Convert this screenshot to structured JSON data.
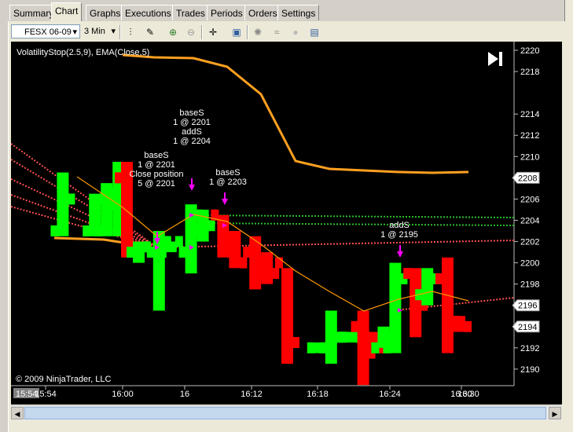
{
  "tabs": [
    {
      "label": "Summary",
      "active": false
    },
    {
      "label": "Chart",
      "active": true
    },
    {
      "label": "Graphs",
      "active": false
    },
    {
      "label": "Executions",
      "active": false
    },
    {
      "label": "Trades",
      "active": false
    },
    {
      "label": "Periods",
      "active": false
    },
    {
      "label": "Orders",
      "active": false
    },
    {
      "label": "Settings",
      "active": false
    }
  ],
  "toolbar": {
    "instrument": "FESX 06-09",
    "interval": "3 Min",
    "icons": [
      "bar-chart-icon",
      "pencil-icon",
      "zoom-in-icon",
      "zoom-out-icon",
      "crosshair-icon",
      "properties-icon",
      "strategy-icon",
      "indicator-icon",
      "refresh-icon",
      "data-box-icon"
    ]
  },
  "chart": {
    "indicator_label": "VolatilityStop(2.5,9), EMA(Close,5)",
    "copyright": "© 2009 NinjaTrader, LLC",
    "time_tick_labels": [
      "15:54",
      "16:00",
      "16",
      "16:06",
      "16:12",
      "16:18",
      "16:24",
      "16:30"
    ],
    "price_tick_labels": [
      "2220",
      "2218",
      "2214",
      "2212",
      "2210",
      "2206",
      "2204",
      "2202",
      "2200",
      "2198",
      "2192",
      "2190"
    ],
    "price_badges": [
      "2208",
      "2196",
      "2194"
    ],
    "cursor_time": "15:54",
    "annotations": [
      {
        "lines": [
          "baseS",
          "1 @ 2201",
          "Close position",
          "5 @ 2201"
        ]
      },
      {
        "lines": [
          "baseS",
          "1 @ 2201",
          "addS",
          "1 @ 2204"
        ]
      },
      {
        "lines": [
          "baseS",
          "1 @ 2203"
        ]
      },
      {
        "lines": [
          "addS",
          "1 @ 2195"
        ]
      }
    ],
    "colors": {
      "up": "#00ff00",
      "down": "#ff0000",
      "ema": "#ff9900",
      "vstop": "#ffa020",
      "bg": "#000000",
      "marker": "#ff00ff"
    }
  },
  "chart_data": {
    "type": "bar",
    "x_range": [
      "15:54",
      "16:33"
    ],
    "ylim": [
      2188.5,
      2220.5
    ],
    "y_ticks": [
      2190,
      2192,
      2194,
      2196,
      2198,
      2200,
      2202,
      2204,
      2206,
      2208,
      2210,
      2212,
      2214,
      2216,
      2218,
      2220
    ],
    "bars": [
      {
        "time": "15:54",
        "open": 2203,
        "high": 2208.5,
        "low": 2202.5,
        "close": 2206
      },
      {
        "time": "15:57",
        "open": 2203,
        "high": 2206.5,
        "low": 2202.5,
        "close": 2206
      },
      {
        "time": "15:57",
        "open": 2203,
        "high": 2207.5,
        "low": 2202.5,
        "close": 2206.5
      },
      {
        "time": "15:57",
        "open": 2205.5,
        "high": 2209.5,
        "low": 2202.5,
        "close": 2208
      },
      {
        "time": "16:00",
        "open": 2208,
        "high": 2209.5,
        "low": 2200.5,
        "close": 2201.5
      },
      {
        "time": "16:00",
        "open": 2201,
        "high": 2202,
        "low": 2200,
        "close": 2201.5
      },
      {
        "time": "16:03",
        "open": 2201,
        "high": 2203,
        "low": 2195.5,
        "close": 2202
      },
      {
        "time": "16:03",
        "open": 2201,
        "high": 2202,
        "low": 2201,
        "close": 2202
      },
      {
        "time": "16:06",
        "open": 2201,
        "high": 2205.5,
        "low": 2199,
        "close": 2204.5
      },
      {
        "time": "16:06",
        "open": 2203,
        "high": 2205,
        "low": 2202,
        "close": 2203.5
      },
      {
        "time": "16:09",
        "open": 2204.5,
        "high": 2204.5,
        "low": 2200.5,
        "close": 2201
      },
      {
        "time": "16:09",
        "open": 2202,
        "high": 2203,
        "low": 2199.5,
        "close": 2200
      },
      {
        "time": "16:12",
        "open": 2201,
        "high": 2202.5,
        "low": 2197.5,
        "close": 2199
      },
      {
        "time": "16:12",
        "open": 2200,
        "high": 2201,
        "low": 2198,
        "close": 2199
      },
      {
        "time": "16:15",
        "open": 2200,
        "high": 2199.5,
        "low": 2190.5,
        "close": 2192.5
      },
      {
        "time": "16:18",
        "open": 2192,
        "high": 2192.5,
        "low": 2191.5,
        "close": 2192
      },
      {
        "time": "16:18",
        "open": 2192,
        "high": 2195.5,
        "low": 2190.5,
        "close": 2193
      },
      {
        "time": "16:21",
        "open": 2193,
        "high": 2193.5,
        "low": 2192.5,
        "close": 2193
      },
      {
        "time": "16:21",
        "open": 2194,
        "high": 2195.5,
        "low": 2188.5,
        "close": 2191.5
      },
      {
        "time": "16:21",
        "open": 2193,
        "high": 2193.5,
        "low": 2191.5,
        "close": 2192
      },
      {
        "time": "16:24",
        "open": 2192,
        "high": 2194,
        "low": 2192,
        "close": 2193
      },
      {
        "time": "16:24",
        "open": 2192,
        "high": 2200,
        "low": 2191.5,
        "close": 2198.5
      },
      {
        "time": "16:27",
        "open": 2199,
        "high": 2199.5,
        "low": 2193,
        "close": 2196
      },
      {
        "time": "16:27",
        "open": 2197,
        "high": 2199.5,
        "low": 2196,
        "close": 2198.5
      },
      {
        "time": "16:30",
        "open": 2198.5,
        "high": 2200.5,
        "low": 2191.5,
        "close": 2194.5
      },
      {
        "time": "16:30",
        "open": 2194.5,
        "high": 2195,
        "low": 2193.5,
        "close": 2194
      }
    ]
  }
}
